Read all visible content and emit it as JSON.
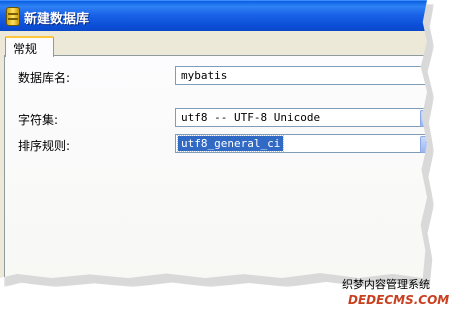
{
  "window": {
    "title": "新建数据库"
  },
  "tabs": [
    {
      "label": "常规"
    }
  ],
  "form": {
    "db_name": {
      "label": "数据库名:",
      "value": "mybatis"
    },
    "charset": {
      "label": "字符集:",
      "value": "utf8 -- UTF-8 Unicode"
    },
    "collation": {
      "label": "排序规则:",
      "value": "utf8_general_ci"
    }
  },
  "watermark": {
    "line1": "织梦内容管理系统",
    "line2": "DEDECMS.COM"
  },
  "colors": {
    "titlebar": "#0a5fe0",
    "selection": "#316ac5",
    "watermark": "#c84020"
  }
}
